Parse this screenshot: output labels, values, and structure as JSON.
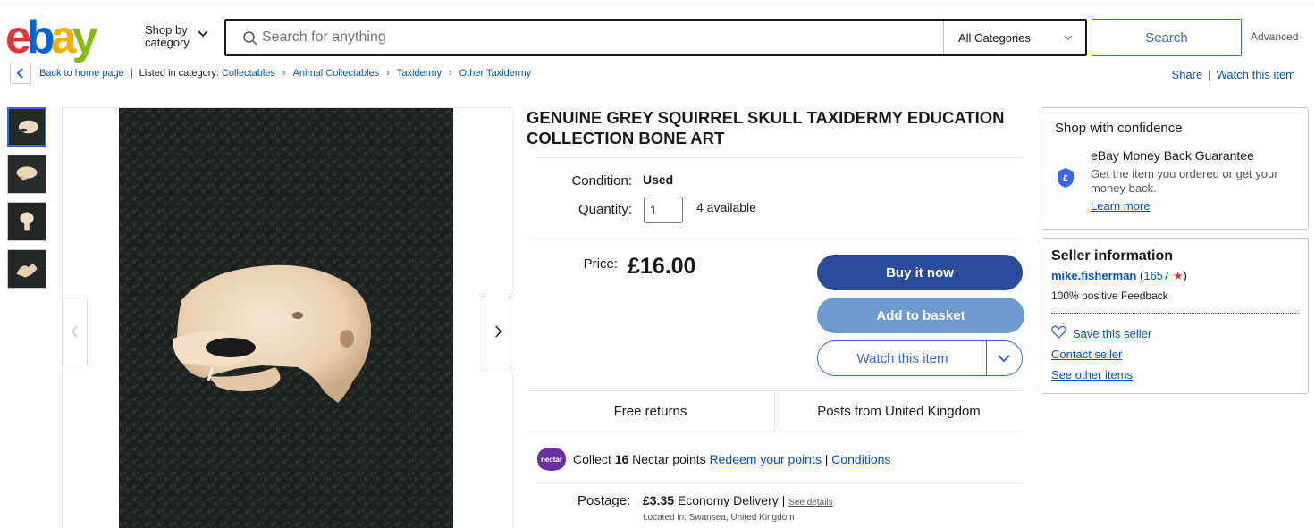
{
  "header": {
    "logo": [
      "e",
      "b",
      "a",
      "y"
    ],
    "shop_by_line1": "Shop by",
    "shop_by_line2": "category",
    "search_placeholder": "Search for anything",
    "category": "All Categories",
    "search_label": "Search",
    "advanced_label": "Advanced"
  },
  "breadcrumb": {
    "back": "Back to home page",
    "listed_in": "Listed in category:",
    "items": [
      "Collectables",
      "Animal Collectables",
      "Taxidermy",
      "Other Taxidermy"
    ],
    "share": "Share",
    "watch": "Watch this item"
  },
  "listing": {
    "title": "GENUINE GREY SQUIRREL SKULL TAXIDERMY EDUCATION COLLECTION BONE ART",
    "condition_label": "Condition:",
    "condition_value": "Used",
    "quantity_label": "Quantity:",
    "quantity_value": "1",
    "available": "4 available",
    "price_label": "Price:",
    "price": "£16.00",
    "buy_now": "Buy it now",
    "add_basket": "Add to basket",
    "watch": "Watch this item",
    "free_returns": "Free returns",
    "posts_from": "Posts from United Kingdom",
    "nectar": {
      "logo_text": "nectar",
      "collect": "Collect",
      "points": "16",
      "points_text": "Nectar points",
      "redeem": "Redeem your points",
      "sep": "|",
      "conditions": "Conditions"
    },
    "postage_label": "Postage:",
    "postage_price": "£3.35",
    "postage_service": "Economy Delivery |",
    "see_details": "See details",
    "located": "Located in: Swansea, United Kingdom"
  },
  "confidence": {
    "title": "Shop with confidence",
    "mbg_title": "eBay Money Back Guarantee",
    "mbg_desc": "Get the item you ordered or get your money back.",
    "learn_more": "Learn more"
  },
  "seller": {
    "title": "Seller information",
    "name": "mike.fisherman",
    "open_paren": "(",
    "score": "1657",
    "close_paren": ")",
    "feedback": "100% positive Feedback",
    "save": "Save this seller",
    "contact": "Contact seller",
    "other": "See other items"
  },
  "colors": {
    "ebay_red": "#e53238",
    "ebay_blue": "#0064d2",
    "ebay_yellow": "#f5af02",
    "ebay_green": "#86b817",
    "buy_button": "#2b4c9c",
    "basket_button": "#6d9bd0",
    "link": "#0654ba",
    "nectar_purple": "#6b2fa0"
  }
}
